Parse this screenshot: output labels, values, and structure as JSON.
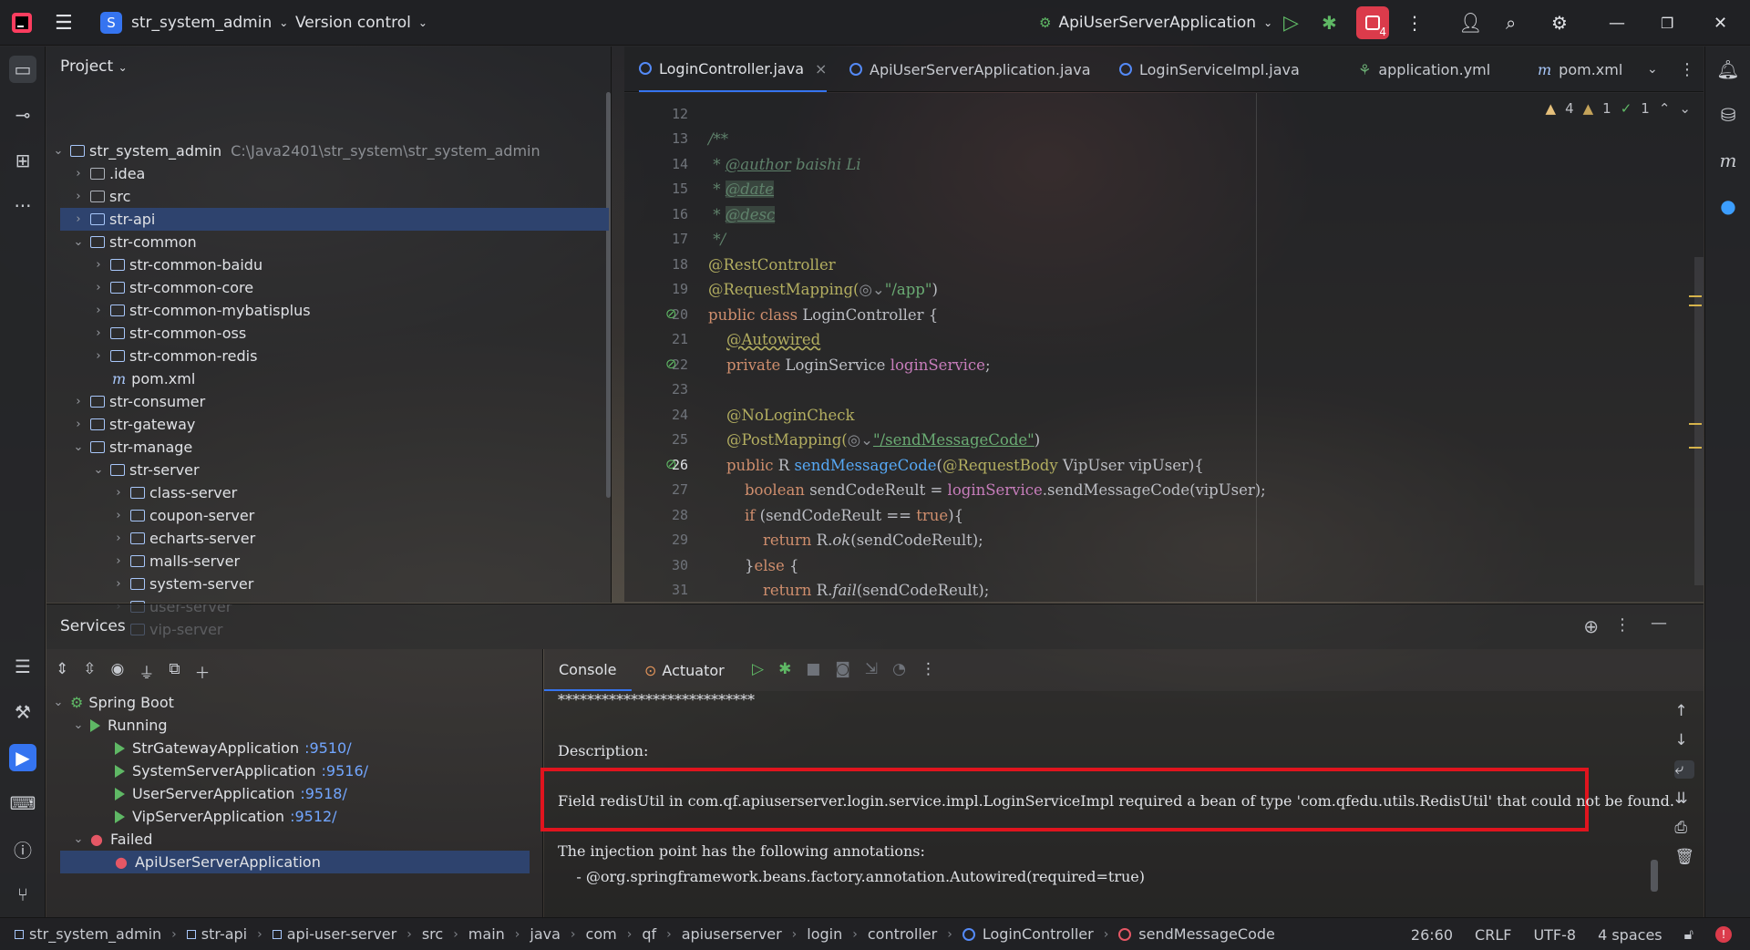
{
  "topbar": {
    "project_name": "str_system_admin",
    "project_badge": "S",
    "vcs_label": "Version control",
    "run_config": "ApiUserServerApplication",
    "services_badge": "4"
  },
  "project_panel": {
    "title": "Project",
    "tree": [
      {
        "label": "str_system_admin",
        "path": "C:\\Java2401\\str_system\\str_system_admin",
        "expanded": true
      },
      {
        "label": ".idea",
        "expanded": false
      },
      {
        "label": "src",
        "expanded": false
      },
      {
        "label": "str-api",
        "expanded": false,
        "selected": true
      },
      {
        "label": "str-common",
        "expanded": true
      },
      {
        "label": "str-common-baidu",
        "expanded": false
      },
      {
        "label": "str-common-core",
        "expanded": false
      },
      {
        "label": "str-common-mybatisplus",
        "expanded": false
      },
      {
        "label": "str-common-oss",
        "expanded": false
      },
      {
        "label": "str-common-redis",
        "expanded": false
      },
      {
        "label": "pom.xml"
      },
      {
        "label": "str-consumer",
        "expanded": false
      },
      {
        "label": "str-gateway",
        "expanded": false
      },
      {
        "label": "str-manage",
        "expanded": true
      },
      {
        "label": "str-server",
        "expanded": true
      },
      {
        "label": "class-server",
        "expanded": false
      },
      {
        "label": "coupon-server",
        "expanded": false
      },
      {
        "label": "echarts-server",
        "expanded": false
      },
      {
        "label": "malls-server",
        "expanded": false
      },
      {
        "label": "system-server",
        "expanded": false
      },
      {
        "label": "user-server",
        "expanded": false
      },
      {
        "label": "vip-server",
        "expanded": false
      }
    ]
  },
  "editor": {
    "tabs": [
      {
        "label": "LoginController.java",
        "active": true,
        "close": "×"
      },
      {
        "label": "ApiUserServerApplication.java"
      },
      {
        "label": "LoginServiceImpl.java"
      },
      {
        "label": "application.yml"
      },
      {
        "label": "pom.xml"
      }
    ],
    "inspections": {
      "warnings": "4",
      "weak": "1",
      "ok": "1"
    },
    "line_numbers": [
      "12",
      "13",
      "14",
      "15",
      "16",
      "17",
      "18",
      "19",
      "20",
      "21",
      "22",
      "23",
      "24",
      "25",
      "26",
      "27",
      "28",
      "29",
      "30",
      "31"
    ],
    "code": {
      "l13": "/**",
      "l14_star": " * ",
      "l14_tag": "@author",
      "l14_rest": " baishi Li",
      "l15_star": " * ",
      "l15_tag": "@date",
      "l16_star": " * ",
      "l16_tag": "@desc",
      "l17": " */",
      "l18": "@RestController",
      "l19_a": "@RequestMapping(",
      "l19_b": "\"/app\"",
      "l19_c": ")",
      "l20_kw": "public class ",
      "l20_rest": "LoginController {",
      "l21": "@Autowired",
      "l22_kw": "private ",
      "l22_type": "LoginService ",
      "l22_fld": "loginService",
      "l22_end": ";",
      "l24": "@NoLoginCheck",
      "l25_a": "@PostMapping(",
      "l25_b": "\"/sendMessageCode\"",
      "l25_c": ")",
      "l26_kw": "public ",
      "l26_type": "R ",
      "l26_fn": "sendMessageCode",
      "l26_p": "(",
      "l26_an": "@RequestBody ",
      "l26_rest": "VipUser vipUser){",
      "l27_kw": "boolean ",
      "l27_a": "sendCodeReult = ",
      "l27_fld": "loginService",
      "l27_b": ".sendMessageCode(vipUser);",
      "l28_kw": "if ",
      "l28_a": "(sendCodeReult == ",
      "l28_true": "true",
      "l28_b": "){",
      "l29_kw": "return ",
      "l29_a": "R.",
      "l29_fn": "ok",
      "l29_b": "(sendCodeReult);",
      "l30_a": "}",
      "l30_kw": "else",
      "l30_b": " {",
      "l31_kw": "return ",
      "l31_a": "R.",
      "l31_fn": "fail",
      "l31_b": "(sendCodeReult);"
    }
  },
  "services": {
    "title": "Services",
    "tree": {
      "root": "Spring Boot",
      "running_label": "Running",
      "running": [
        {
          "name": "StrGatewayApplication",
          "port": ":9510/"
        },
        {
          "name": "SystemServerApplication",
          "port": ":9516/"
        },
        {
          "name": "UserServerApplication",
          "port": ":9518/"
        },
        {
          "name": "VipServerApplication",
          "port": ":9512/"
        }
      ],
      "failed_label": "Failed",
      "failed": [
        {
          "name": "ApiUserServerApplication",
          "selected": true
        }
      ]
    },
    "console_tabs": {
      "console": "Console",
      "actuator": "Actuator"
    },
    "console": {
      "stars": "***************************",
      "description": "Description:",
      "error": "Field redisUtil in com.qf.apiuserserver.login.service.impl.LoginServiceImpl required a bean of type 'com.qfedu.utils.RedisUtil' that could not be found.",
      "injection": "The injection point has the following annotations:",
      "annotation": "    - @org.springframework.beans.factory.annotation.Autowired(required=true)"
    }
  },
  "statusbar": {
    "breadcrumb": [
      "str_system_admin",
      "str-api",
      "api-user-server",
      "src",
      "main",
      "java",
      "com",
      "qf",
      "apiuserserver",
      "login",
      "controller",
      "LoginController",
      "sendMessageCode"
    ],
    "position": "26:60",
    "line_sep": "CRLF",
    "encoding": "UTF-8",
    "indent": "4 spaces"
  },
  "colors": {
    "accent": "#3574f0",
    "error_box": "#e0141e",
    "selection": "#2e436e"
  }
}
